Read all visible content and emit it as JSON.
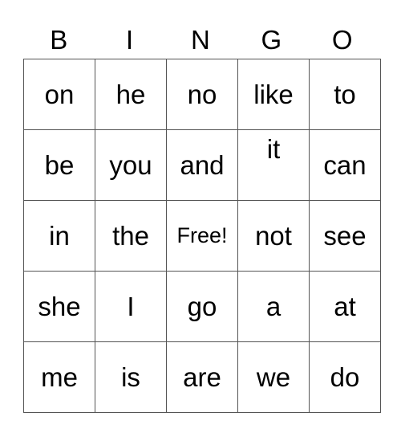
{
  "header": [
    "B",
    "I",
    "N",
    "G",
    "O"
  ],
  "rows": [
    [
      "on",
      "he",
      "no",
      "like",
      "to"
    ],
    [
      "be",
      "you",
      "and",
      "it",
      "can"
    ],
    [
      "in",
      "the",
      "Free!",
      "not",
      "see"
    ],
    [
      "she",
      "I",
      "go",
      "a",
      "at"
    ],
    [
      "me",
      "is",
      "are",
      "we",
      "do"
    ]
  ]
}
